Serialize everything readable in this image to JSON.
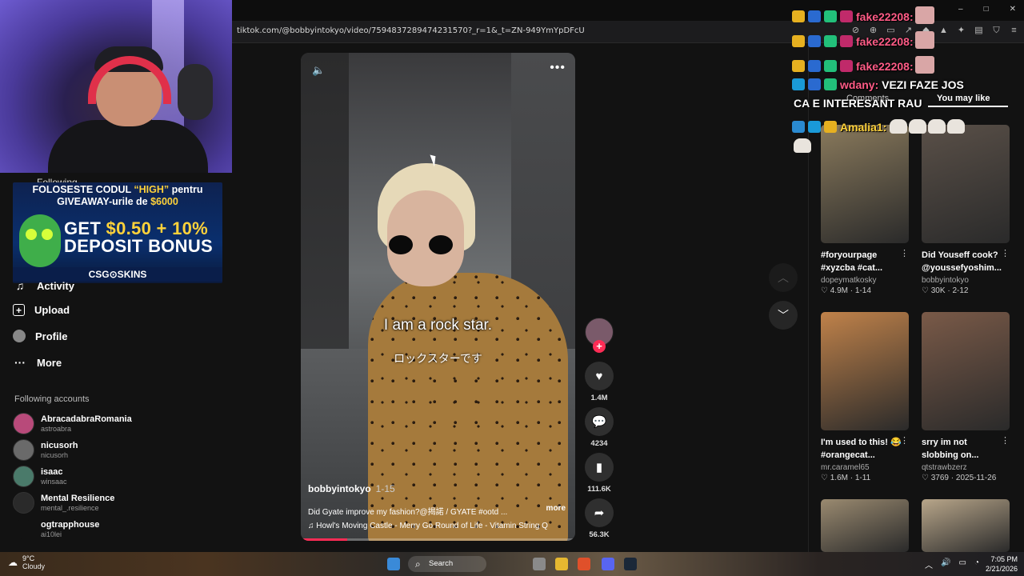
{
  "browser": {
    "url": "tiktok.com/@bobbyintokyo/video/7594837289474231570?_r=1&_t=ZN-949YmYpDFcU",
    "window_controls": [
      "–",
      "□",
      "✕"
    ]
  },
  "sidebar": {
    "following_label": "Following",
    "promo": {
      "line1_a": "FOLOSESTE CODUL ",
      "line1_code": "“HIGH”",
      "line1_b": " pentru",
      "line2_a": "GIVEAWAY-urile de ",
      "line2_amount": "$6000",
      "big1_a": "GET ",
      "big1_b": "$0.50 + 10%",
      "big2": "DEPOSIT BONUS",
      "brand": "CSG⊙SKINS"
    },
    "nav": [
      {
        "label": "Activity",
        "icon": "bell-icon"
      },
      {
        "label": "Upload",
        "icon": "plus-square-icon"
      },
      {
        "label": "Profile",
        "icon": "person-icon"
      },
      {
        "label": "More",
        "icon": "more-dots-icon"
      }
    ],
    "following_accounts_title": "Following accounts",
    "accounts": [
      {
        "name": "AbracadabraRomania",
        "handle": "astroabra"
      },
      {
        "name": "nicusorh",
        "handle": "nicusorh"
      },
      {
        "name": "isaac",
        "handle": "winsaac"
      },
      {
        "name": "Mental Resilience",
        "handle": "mental_.resilience"
      },
      {
        "name": "ogtrapphouse",
        "handle": "ai10lei"
      }
    ]
  },
  "video": {
    "subtitle_en": "I am a rock star.",
    "subtitle_jp": "ロックスターです",
    "author": "bobbyintokyo",
    "date": "1-15",
    "description": "Did Gyate improve my fashion?@揭諾 / GYATE #ootd ...",
    "more_label": "more",
    "music": "♫  Howl's Moving Castle - Merry Go Round of Life - Vitamin String Q",
    "progress": 0.17
  },
  "actions": {
    "likes": "1.4M",
    "comments": "4234",
    "saves": "111.6K",
    "shares": "56.3K"
  },
  "right_panel": {
    "tabs": [
      "Comments",
      "You may like"
    ],
    "cards": [
      {
        "title": "#foryourpage #xyzcba #cat...",
        "user": "dopeymatkosky",
        "likes": "4.9M",
        "date": "1-14",
        "thumb": "#8a7a5c"
      },
      {
        "title": "Did Youseff cook? @youssefyoshim...",
        "user": "bobbyintokyo",
        "likes": "30K",
        "date": "2-12",
        "thumb": "#5a5048"
      },
      {
        "title": "I'm used to this! 😂 #orangecat...",
        "user": "mr.caramel65",
        "likes": "1.6M",
        "date": "1-11",
        "thumb": "#c0824a"
      },
      {
        "title": "srry im not slobbing on...",
        "user": "qtstrawbzerz",
        "likes": "3769",
        "date": "2025-11-26",
        "thumb": "#7a5a48"
      },
      {
        "title": "",
        "user": "",
        "likes": "",
        "date": "",
        "thumb": "#9a8a70"
      },
      {
        "title": "",
        "user": "",
        "likes": "",
        "date": "",
        "thumb": "#b8a68a"
      }
    ]
  },
  "chat": [
    {
      "user": "fake22208:",
      "msg": ""
    },
    {
      "user": "fake22208:",
      "msg": ""
    },
    {
      "user": "fake22208:",
      "msg": ""
    },
    {
      "user": "wdany:",
      "msg": " VEZI FAZE JOS"
    },
    {
      "user": "",
      "msg": "CA E INTERESANT RAU"
    },
    {
      "user": "Amalia1:",
      "msg": ""
    }
  ],
  "taskbar": {
    "temp": "9°C",
    "condition": "Cloudy",
    "search": "Search",
    "time": "7:05 PM",
    "date": "2/21/2026"
  },
  "colors": {
    "accent": "#fe2c55",
    "background": "#121212"
  }
}
